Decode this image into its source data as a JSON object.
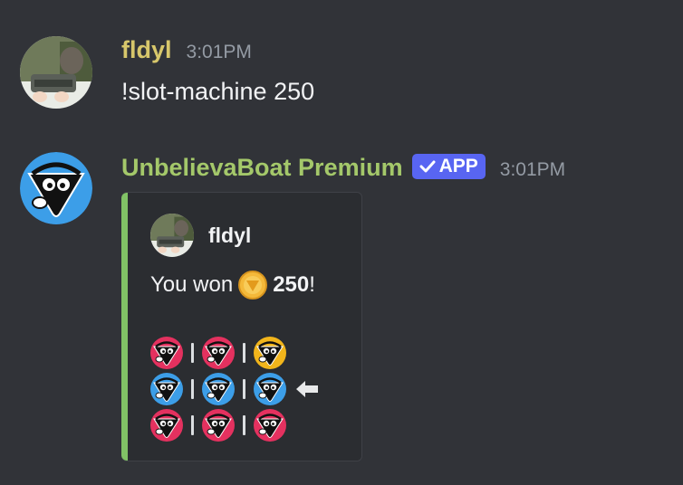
{
  "messages": [
    {
      "username": "fldyl",
      "username_color": "#d7c76b",
      "timestamp": "3:01PM",
      "content": "!slot-machine 250",
      "avatar_icon": "user-photo-avatar"
    },
    {
      "username": "UnbelievaBoat Premium",
      "username_color": "#a4c86a",
      "app_tag": "APP",
      "timestamp": "3:01PM",
      "avatar_icon": "unbelievaboat-avatar",
      "embed": {
        "accent_color": "#81c266",
        "author_name": "fldyl",
        "won_prefix": "You won",
        "amount": "250",
        "won_suffix": "!",
        "coin_icon": "coin-icon",
        "slots": [
          [
            "pink",
            "pink",
            "yellow"
          ],
          [
            "blue",
            "blue",
            "blue"
          ],
          [
            "pink",
            "pink",
            "pink"
          ]
        ],
        "winning_row_marker": "left-arrow-icon"
      }
    }
  ],
  "colors": {
    "background": "#313338",
    "slot_pink": "#e4315f",
    "slot_blue": "#3c9ee8",
    "slot_yellow": "#f2b51b",
    "app_tag": "#5865f2"
  }
}
